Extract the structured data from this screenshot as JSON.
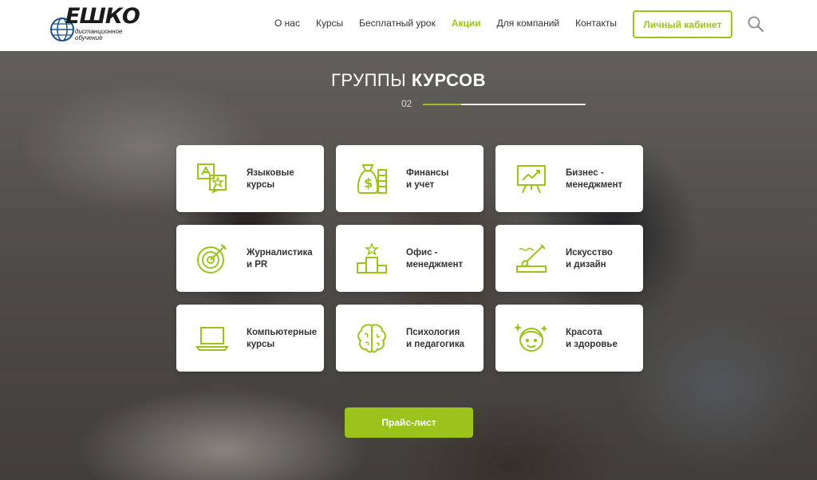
{
  "logo": {
    "title": "ЕШКО",
    "subtitle_line1": "дистанционное",
    "subtitle_line2": "обучение"
  },
  "nav": {
    "items": [
      {
        "label": "О нас"
      },
      {
        "label": "Курсы"
      },
      {
        "label": "Бесплатный урок"
      },
      {
        "label": "Акции",
        "active": true
      },
      {
        "label": "Для компаний"
      },
      {
        "label": "Контакты"
      }
    ],
    "cabinet_label": "Личный кабинет"
  },
  "section": {
    "title_light": "ГРУППЫ",
    "title_bold": "КУРСОВ",
    "number": "02"
  },
  "cards": [
    {
      "line1": "Языковые",
      "line2": "курсы",
      "icon": "translate-icon"
    },
    {
      "line1": "Финансы",
      "line2": "и учет",
      "icon": "money-bag-icon"
    },
    {
      "line1": "Бизнес -",
      "line2": "менеджмент",
      "icon": "presentation-chart-icon"
    },
    {
      "line1": "Журналистика",
      "line2": "и PR",
      "icon": "target-icon"
    },
    {
      "line1": "Офис -",
      "line2": "менеджмент",
      "icon": "podium-icon"
    },
    {
      "line1": "Искусство",
      "line2": "и дизайн",
      "icon": "paint-brush-icon"
    },
    {
      "line1": "Компьютерные",
      "line2": "курсы",
      "icon": "laptop-icon"
    },
    {
      "line1": "Психология",
      "line2": "и педагогика",
      "icon": "brain-icon"
    },
    {
      "line1": "Красота",
      "line2": "и здоровье",
      "icon": "face-icon"
    }
  ],
  "price_button": "Прайс-лист",
  "colors": {
    "accent": "#9cc31b",
    "text": "#333333"
  }
}
